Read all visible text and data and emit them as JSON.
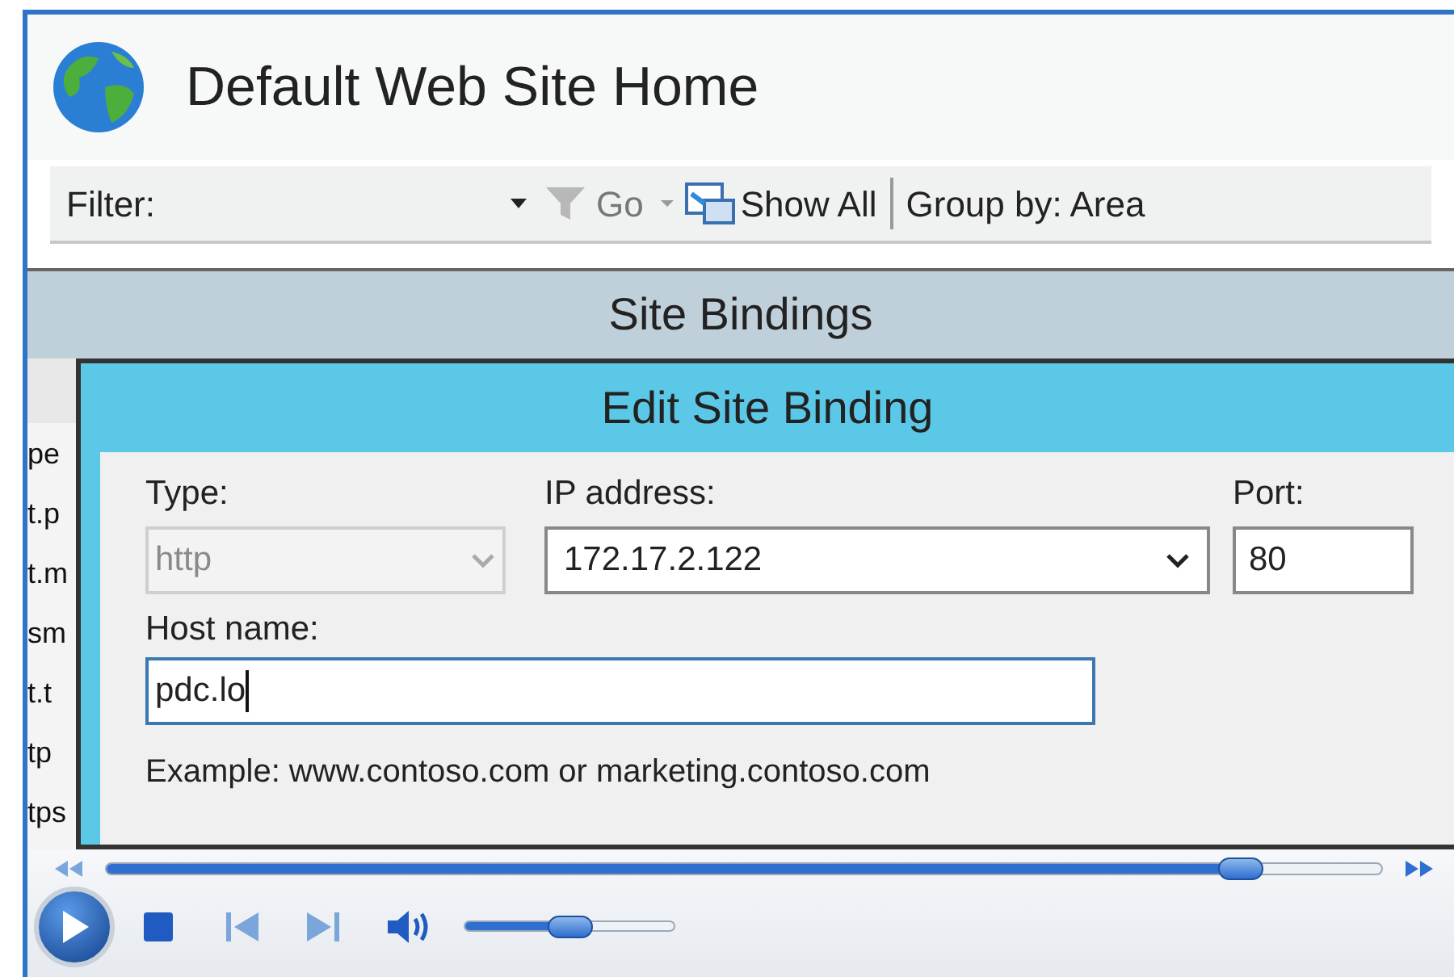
{
  "window": {
    "title": "Default Web Site Home"
  },
  "toolbar": {
    "filter_label": "Filter:",
    "go_label": "Go",
    "show_all": "Show All",
    "group_by": "Group by: Area"
  },
  "site_bindings": {
    "title": "Site Bindings",
    "column_fragments": [
      "pe",
      "t.p",
      "t.m",
      "sm",
      "t.t",
      "tp",
      "tps"
    ]
  },
  "edit_dialog": {
    "title": "Edit Site Binding",
    "type": {
      "label": "Type:",
      "value": "http",
      "disabled": true
    },
    "ip": {
      "label": "IP address:",
      "value": "172.17.2.122"
    },
    "port": {
      "label": "Port:",
      "value": "80"
    },
    "host": {
      "label": "Host name:",
      "value": "pdc.lo",
      "focused": true
    },
    "example": "Example: www.contoso.com or marketing.contoso.com"
  },
  "player": {
    "seek": {
      "level": 0.89
    },
    "volume": {
      "level": 0.5
    }
  }
}
